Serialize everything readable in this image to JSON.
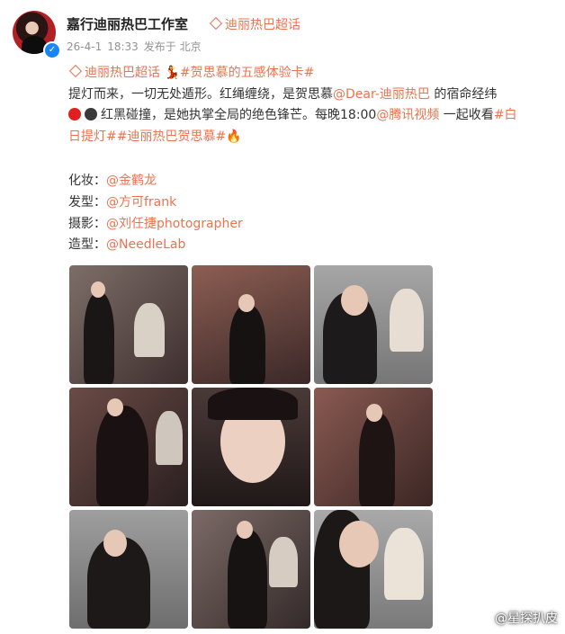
{
  "post": {
    "author": "嘉行迪丽热巴工作室",
    "super_topic": "迪丽热巴超话",
    "date": "26-4-1",
    "time": "18:33",
    "location": "发布于 北京",
    "topic_tag": "迪丽热巴超话",
    "hashtag1": "#贺思慕的五感体验卡#",
    "line2_a": "提灯而来，一切无处遁形。红绳缠绕，是贺思慕",
    "mention1": "@Dear-迪丽热巴",
    "line2_b": " 的宿命经纬",
    "line3_a": "红黑碰撞，是她执掌全局的绝色锋芒。每晚18:00",
    "mention2": "@腾讯视频",
    "line3_b": " 一起收看",
    "hashtag2a": "#白",
    "hashtag2b": "日提灯#",
    "hashtag3": "#迪丽热巴贺思慕#"
  },
  "credits": [
    {
      "label": "化妆：",
      "value": "@金鹤龙"
    },
    {
      "label": "发型：",
      "value": "@方可frank"
    },
    {
      "label": "摄影：",
      "value": "@刘任捷photographer"
    },
    {
      "label": "造型：",
      "value": "@NeedleLab"
    }
  ],
  "icons": {
    "verify": "verified-badge-icon",
    "topic": "diamond-icon",
    "red_circle": "red-circle-icon",
    "black_circle": "black-circle-icon",
    "fire": "fire-icon",
    "dancer": "dancer-icon"
  },
  "colors": {
    "link": "#eb7350",
    "verify": "#1a86f5"
  },
  "watermark": "@星探扒皮"
}
